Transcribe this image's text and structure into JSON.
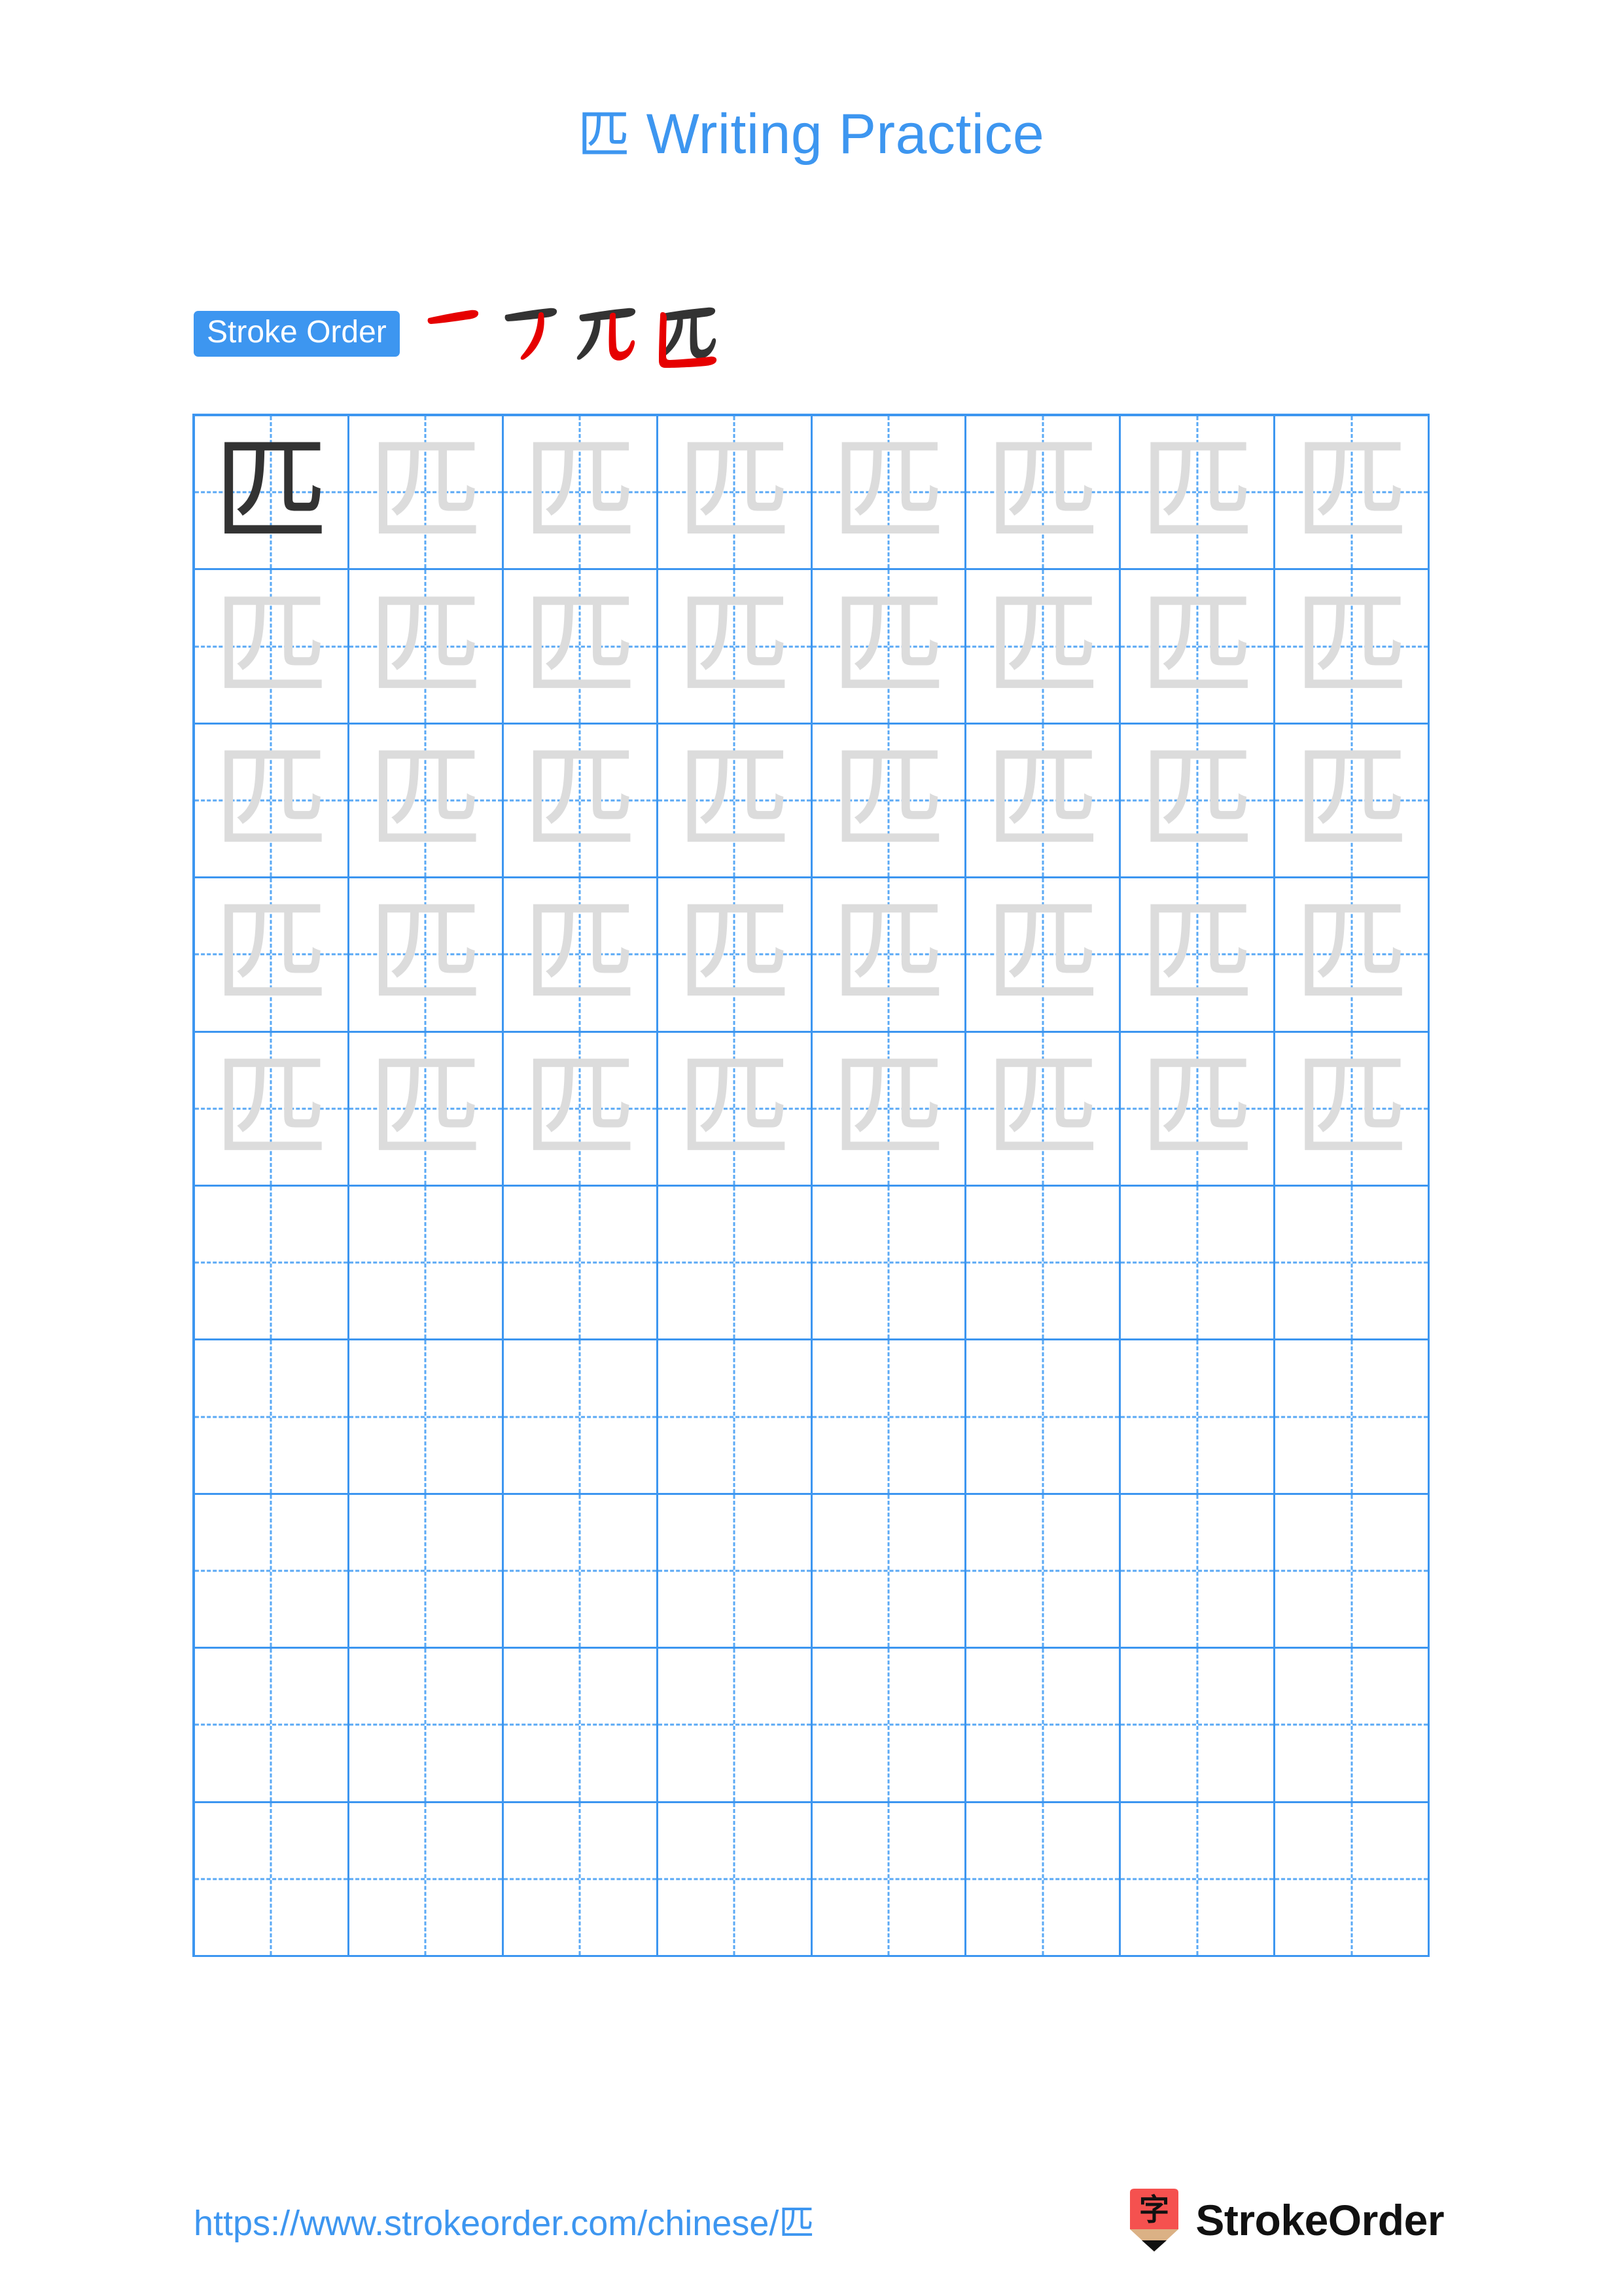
{
  "page": {
    "character": "匹",
    "title": "匹 Writing Practice",
    "title_prefix_char": "匹",
    "title_text": " Writing Practice",
    "background_color": "#ffffff",
    "accent_color": "#3d96f0",
    "grid_line_color": "#3d96f0",
    "guide_line_color": "#5aa9f5",
    "dark_char_color": "#333333",
    "light_char_color": "#dcdcdc",
    "stroke_new_color": "#e60000",
    "stroke_old_color": "#333333"
  },
  "stroke_order": {
    "badge_label": "Stroke Order",
    "total_strokes": 4,
    "steps": [
      {
        "index": 1,
        "partial": "一",
        "new_stroke": "horizontal"
      },
      {
        "index": 2,
        "partial": "厂",
        "new_stroke": "falling-left"
      },
      {
        "index": 3,
        "partial": "兀",
        "new_stroke": "vertical-hook"
      },
      {
        "index": 4,
        "partial": "匹",
        "new_stroke": "enclosing-bottom"
      }
    ]
  },
  "grid": {
    "columns": 8,
    "rows": 10,
    "cells": [
      [
        "dark",
        "light",
        "light",
        "light",
        "light",
        "light",
        "light",
        "light"
      ],
      [
        "light",
        "light",
        "light",
        "light",
        "light",
        "light",
        "light",
        "light"
      ],
      [
        "light",
        "light",
        "light",
        "light",
        "light",
        "light",
        "light",
        "light"
      ],
      [
        "light",
        "light",
        "light",
        "light",
        "light",
        "light",
        "light",
        "light"
      ],
      [
        "light",
        "light",
        "light",
        "light",
        "light",
        "light",
        "light",
        "light"
      ],
      [
        "empty",
        "empty",
        "empty",
        "empty",
        "empty",
        "empty",
        "empty",
        "empty"
      ],
      [
        "empty",
        "empty",
        "empty",
        "empty",
        "empty",
        "empty",
        "empty",
        "empty"
      ],
      [
        "empty",
        "empty",
        "empty",
        "empty",
        "empty",
        "empty",
        "empty",
        "empty"
      ],
      [
        "empty",
        "empty",
        "empty",
        "empty",
        "empty",
        "empty",
        "empty",
        "empty"
      ],
      [
        "empty",
        "empty",
        "empty",
        "empty",
        "empty",
        "empty",
        "empty",
        "empty"
      ]
    ]
  },
  "footer": {
    "url": "https://www.strokeorder.com/chinese/匹",
    "brand_name": "StrokeOrder",
    "logo_char": "字",
    "logo_body_color": "#f5514f",
    "logo_wood_color": "#dbb185",
    "logo_tip_color": "#111111"
  }
}
